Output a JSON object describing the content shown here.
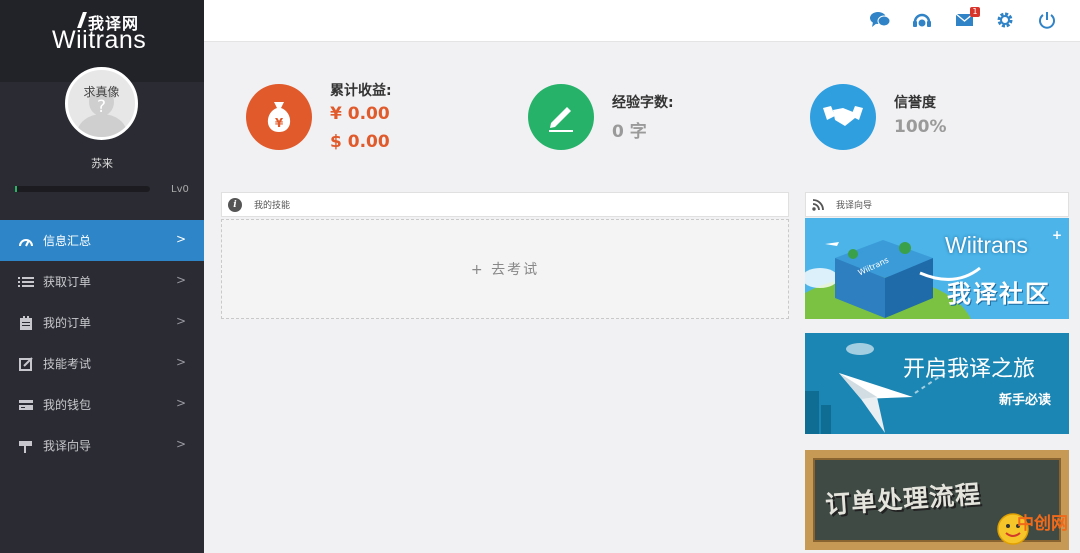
{
  "brand": {
    "logo_cn": "我译网",
    "logo_en": "Wiitrans"
  },
  "profile": {
    "avatar_text": "求真像",
    "avatar_mark": "?",
    "username": "苏来",
    "level": "Lv0",
    "level_progress": 0.01
  },
  "nav": {
    "items": [
      {
        "label": "信息汇总",
        "icon": "dashboard-icon",
        "active": true
      },
      {
        "label": "获取订单",
        "icon": "list-icon",
        "active": false
      },
      {
        "label": "我的订单",
        "icon": "clipboard-icon",
        "active": false
      },
      {
        "label": "技能考试",
        "icon": "edit-icon",
        "active": false
      },
      {
        "label": "我的钱包",
        "icon": "wallet-icon",
        "active": false
      },
      {
        "label": "我译向导",
        "icon": "signpost-icon",
        "active": false
      }
    ],
    "arrow": ">"
  },
  "topbar": {
    "icons": [
      "chat-icon",
      "headset-icon",
      "mail-icon",
      "gear-icon",
      "power-icon"
    ],
    "mail_badge": "1"
  },
  "stats": {
    "earnings": {
      "title": "累计收益:",
      "cny": "¥ 0.00",
      "usd": "$ 0.00",
      "color": "#e05a2b"
    },
    "experience": {
      "title": "经验字数:",
      "value": "0 字",
      "color": "#27b26a"
    },
    "reputation": {
      "title": "信誉度",
      "value": "100%",
      "color": "#2f9fe0"
    }
  },
  "panels": {
    "skills_title": "我的技能",
    "exam_button": "+ 去考试",
    "guide_title": "我译向导"
  },
  "banners": {
    "community": {
      "brand": "Wiitrans",
      "title": "我译社区",
      "cube_text": "Wiitrans"
    },
    "journey": {
      "title": "开启我译之旅",
      "subtitle": "新手必读"
    },
    "process": {
      "title": "订单处理流程"
    }
  },
  "watermark": {
    "text": "中创网"
  },
  "colors": {
    "sidebar": "#2b2c33",
    "active": "#2e86c8",
    "accent": "#2f83c6"
  }
}
